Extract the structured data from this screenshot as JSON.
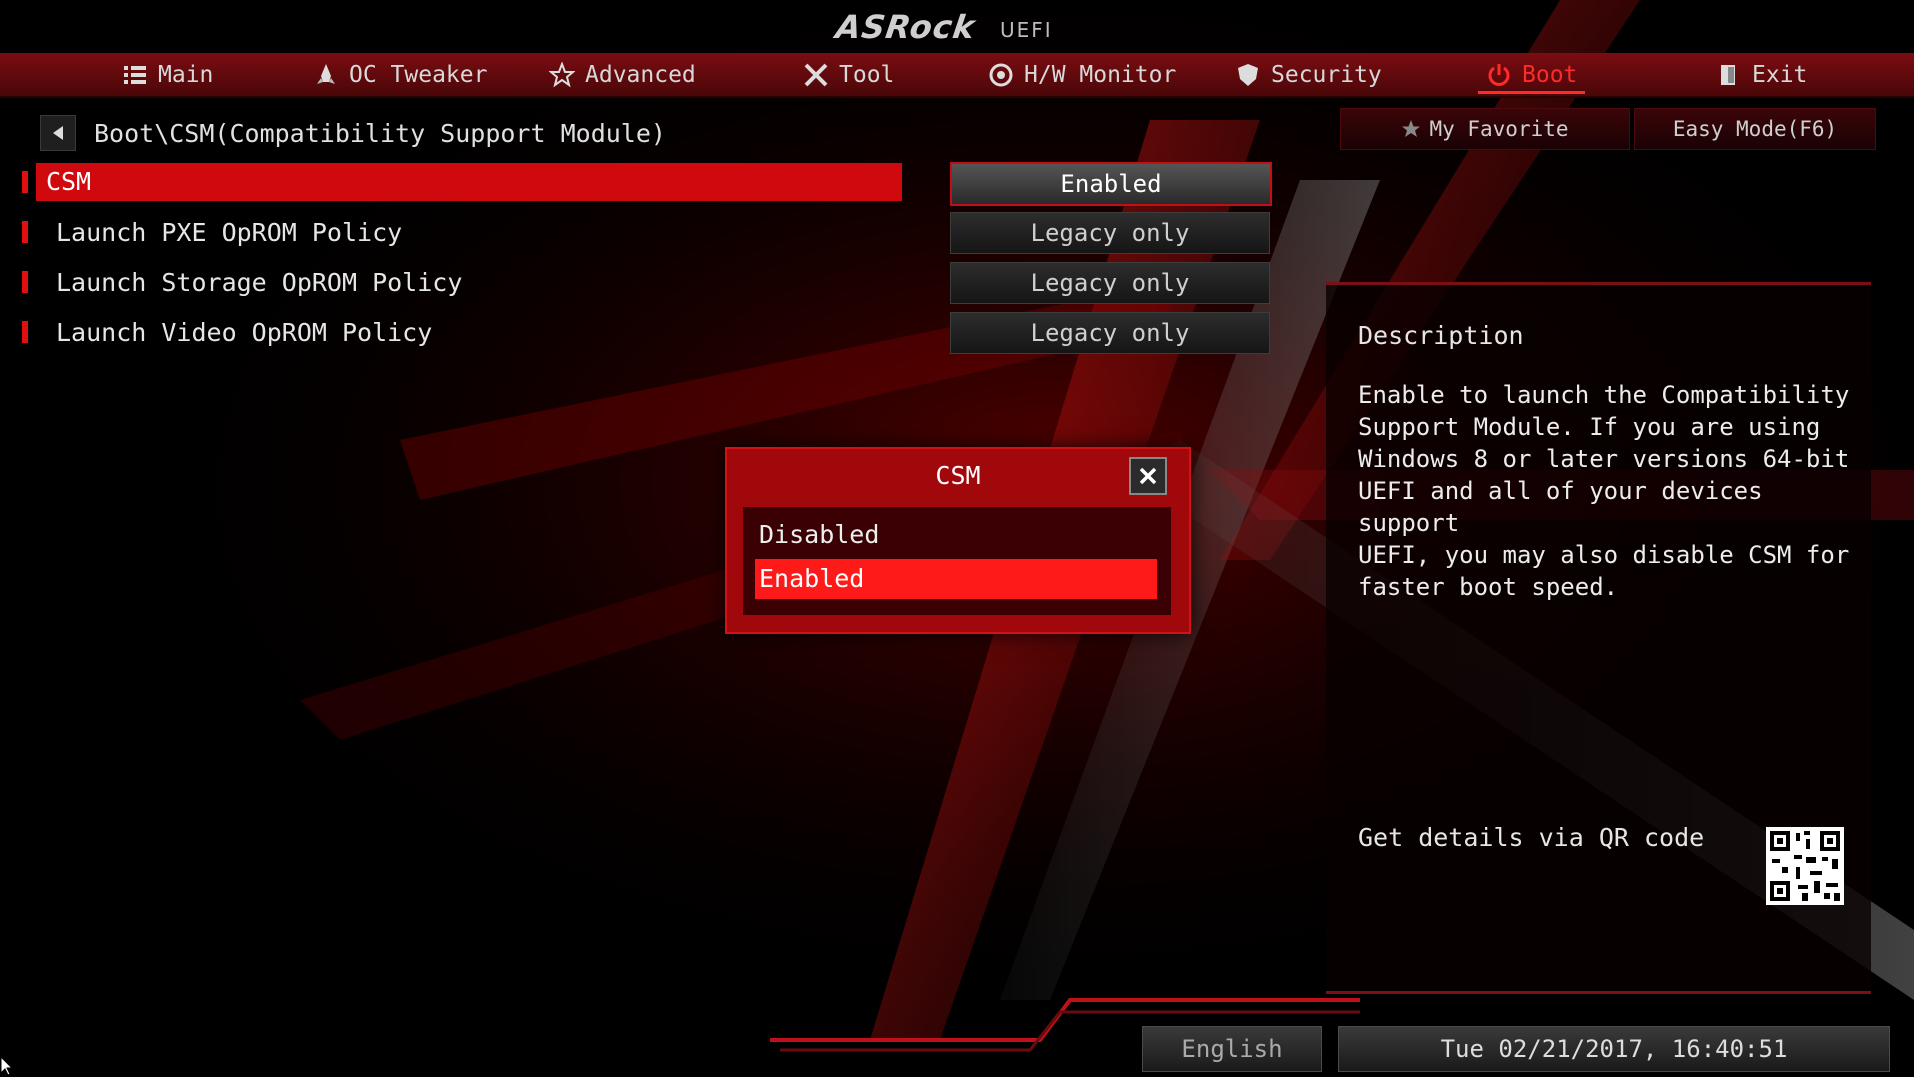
{
  "logo": {
    "brand": "ASRock",
    "sub": "UEFI"
  },
  "nav": [
    {
      "label": "Main",
      "icon": "list-icon"
    },
    {
      "label": "OC Tweaker",
      "icon": "rocket-icon"
    },
    {
      "label": "Advanced",
      "icon": "star-icon"
    },
    {
      "label": "Tool",
      "icon": "tools-icon"
    },
    {
      "label": "H/W Monitor",
      "icon": "monitor-icon"
    },
    {
      "label": "Security",
      "icon": "shield-icon"
    },
    {
      "label": "Boot",
      "icon": "power-icon",
      "active": true
    },
    {
      "label": "Exit",
      "icon": "exit-icon"
    }
  ],
  "breadcrumb": "Boot\\CSM(Compatibility Support Module)",
  "top_buttons": {
    "favorite": "My Favorite",
    "easy_mode": "Easy Mode(F6)"
  },
  "settings": [
    {
      "label": "CSM",
      "value": "Enabled",
      "selected": true
    },
    {
      "label": "Launch PXE OpROM Policy",
      "value": "Legacy only"
    },
    {
      "label": "Launch Storage OpROM Policy",
      "value": "Legacy only"
    },
    {
      "label": "Launch Video OpROM Policy",
      "value": "Legacy only"
    }
  ],
  "description": {
    "title": "Description",
    "body": "Enable to launch the Compatibility\nSupport Module. If you are using\nWindows 8 or later versions 64-bit\nUEFI and all of your devices support\nUEFI, you may also disable CSM for\nfaster boot speed.",
    "qr_label": "Get details via QR code"
  },
  "dialog": {
    "title": "CSM",
    "options": [
      "Disabled",
      "Enabled"
    ],
    "selected": "Enabled"
  },
  "footer": {
    "language": "English",
    "datetime": "Tue 02/21/2017, 16:40:51"
  },
  "colors": {
    "accent": "#d0090f",
    "nav_bg": "#6a0a0e",
    "active_tab": "#ff2a2a"
  }
}
